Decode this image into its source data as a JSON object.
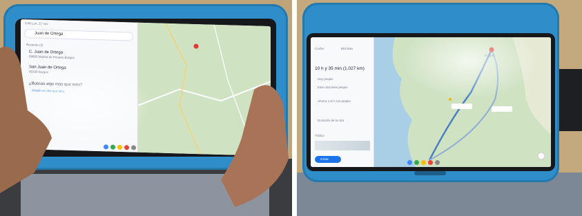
{
  "left_photo": {
    "status_time": "3:46  Lun, 27 nov",
    "search_query": "Juan de Ortega",
    "section_header": "Reciente (2)",
    "results": [
      {
        "title": "C. Juan de Ortega",
        "subtitle": "09600 Madrid de Pinares Burgos"
      },
      {
        "title": "San Juan de Ortega",
        "subtitle": "09199 Burgos"
      }
    ],
    "prompt": "¿Buscas algo más que esto?",
    "prompt_link": "Añadir un sitio que falta"
  },
  "right_photo": {
    "tabs": [
      "Coche",
      "Bicicleta"
    ],
    "duration": "10 h y 35 min (1.027 km)",
    "route_notes": [
      "Hay peajes",
      "Este ruta tiene peajes",
      "Ahorra 1,5 h con peajes",
      "Duración de la ruta"
    ],
    "map_label": "Burgos",
    "section": "Tráfico",
    "start_button": "Iniciar"
  },
  "colors": {
    "case": "#2f8ec9",
    "map_land": "#cfe2c2",
    "sea": "#a9cfe6",
    "route": "#4a7fc1",
    "accent": "#1a73e8"
  }
}
